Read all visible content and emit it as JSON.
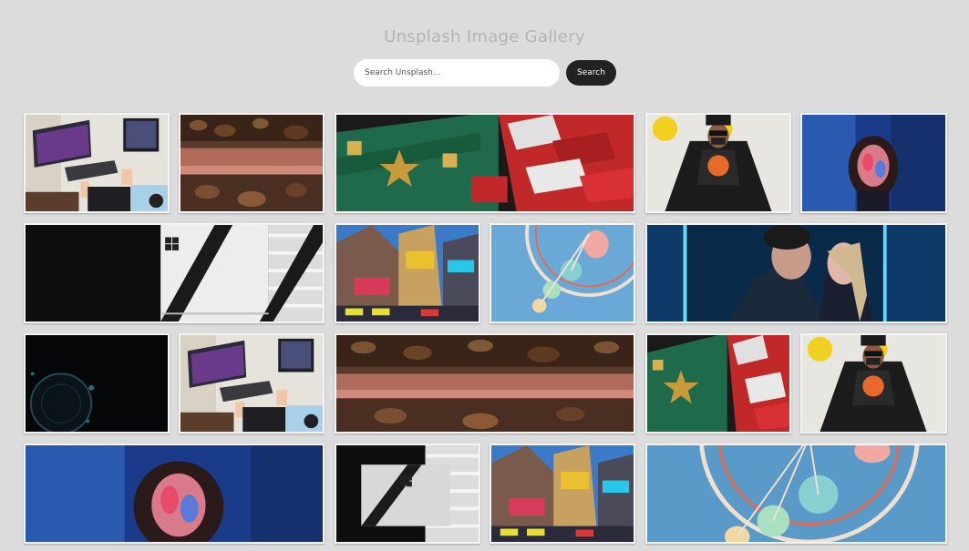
{
  "header": {
    "title": "Unsplash Image Gallery"
  },
  "search": {
    "placeholder": "Search Unsplash...",
    "value": "",
    "button_label": "Search"
  },
  "gallery": {
    "images": [
      {
        "subject": "desk-computer"
      },
      {
        "subject": "abstract-paint"
      },
      {
        "subject": "chinatown-signs"
      },
      {
        "subject": "kenzo-person"
      },
      {
        "subject": "neon-portrait"
      },
      {
        "subject": "shadow-laptop"
      },
      {
        "subject": "times-square"
      },
      {
        "subject": "ferris-wheel"
      },
      {
        "subject": "neon-couple"
      },
      {
        "subject": "dark-circle"
      },
      {
        "subject": "desk-computer"
      },
      {
        "subject": "abstract-paint"
      },
      {
        "subject": "chinatown-signs"
      },
      {
        "subject": "kenzo-person"
      },
      {
        "subject": "neon-portrait"
      },
      {
        "subject": "shadow-laptop"
      },
      {
        "subject": "times-square"
      },
      {
        "subject": "ferris-wheel"
      }
    ]
  }
}
